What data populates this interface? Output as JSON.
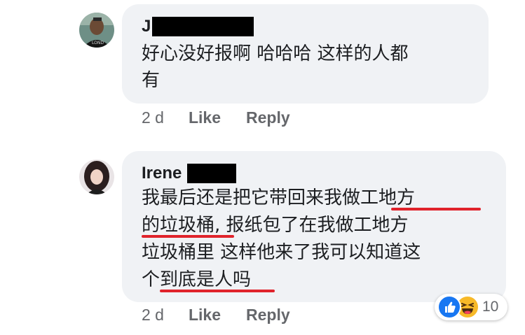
{
  "comments": [
    {
      "author": "J",
      "lines": [
        "好心没好报啊 哈哈哈 这样的人都",
        "有"
      ],
      "time": "2 d",
      "like_label": "Like",
      "reply_label": "Reply"
    },
    {
      "author": "Irene",
      "lines": [
        "我最后还是把它带回来我做工地方",
        "的垃圾桶, 报纸包了在我做工地方",
        "垃圾桶里 这样他来了我可以知道这",
        "个到底是人吗"
      ],
      "time": "2 d",
      "like_label": "Like",
      "reply_label": "Reply",
      "reactions": {
        "types": [
          "like-icon",
          "haha-icon"
        ],
        "count": "10"
      }
    }
  ],
  "colors": {
    "bubble": "#f0f2f5",
    "meta_text": "#65676b",
    "underline": "#e0232b",
    "like_blue": "#1877f2",
    "haha_yellow": "#f7b928"
  }
}
